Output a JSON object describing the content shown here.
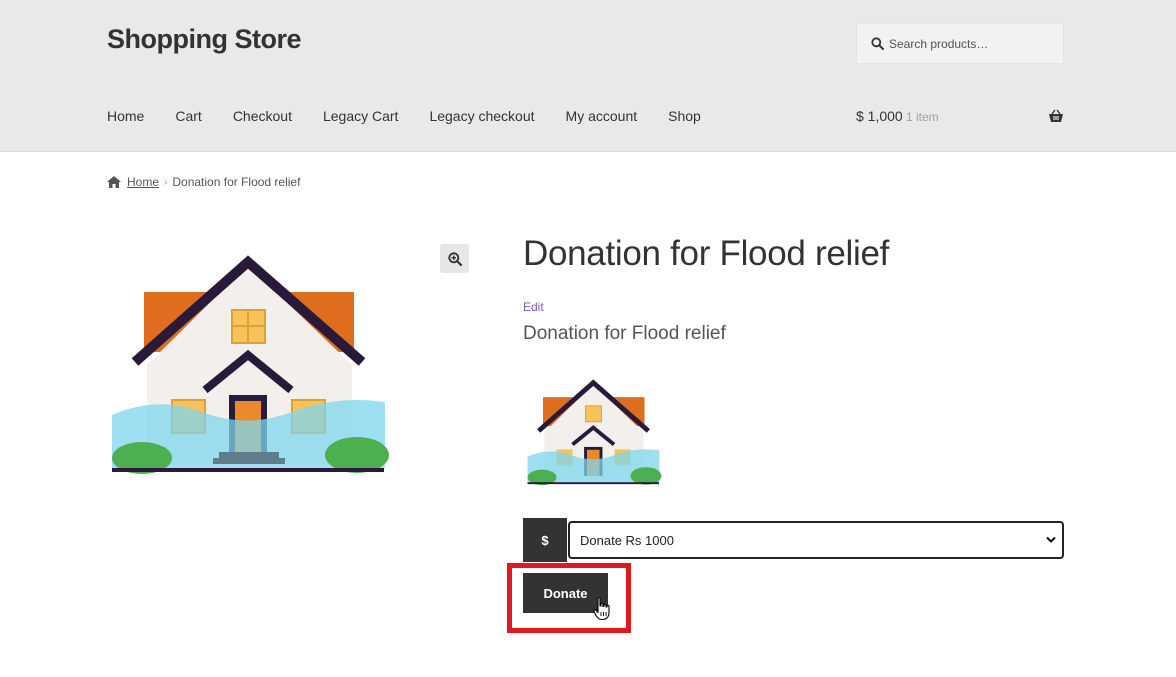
{
  "header": {
    "site_title": "Shopping Store",
    "search_placeholder": "Search products…"
  },
  "nav": [
    {
      "label": "Home"
    },
    {
      "label": "Cart"
    },
    {
      "label": "Checkout"
    },
    {
      "label": "Legacy Cart"
    },
    {
      "label": "Legacy checkout"
    },
    {
      "label": "My account"
    },
    {
      "label": "Shop"
    }
  ],
  "cart": {
    "amount": "$ 1,000",
    "count": "1 item"
  },
  "breadcrumb": {
    "home": "Home",
    "current": "Donation for Flood relief"
  },
  "product": {
    "title": "Donation for Flood relief",
    "edit_label": "Edit",
    "short_description": "Donation for Flood relief",
    "currency_symbol": "$",
    "selected_option": "Donate Rs 1000",
    "donate_label": "Donate"
  },
  "colors": {
    "header_bg": "#e9e9e9",
    "button_bg": "#333333",
    "highlight": "#e3171f",
    "edit_link": "#7f54b3"
  }
}
